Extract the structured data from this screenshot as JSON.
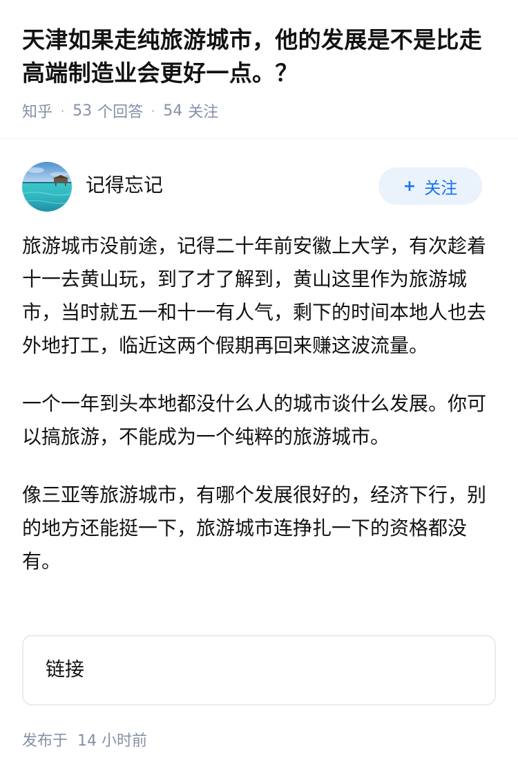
{
  "question": {
    "title": "天津如果走纯旅游城市，他的发展是不是比走高端制造业会更好一点。？",
    "source": "知乎",
    "answer_count": "53",
    "answer_label": "个回答",
    "follower_count": "54",
    "follower_label": "关注"
  },
  "answer": {
    "author_name": "记得忘记",
    "follow_label": "关注",
    "follow_plus": "+",
    "paragraphs": [
      "旅游城市没前途，记得二十年前安徽上大学，有次趁着十一去黄山玩，到了才了解到，黄山这里作为旅游城市，当时就五一和十一有人气，剩下的时间本地人也去外地打工，临近这两个假期再回来赚这波流量。",
      "一个一年到头本地都没什么人的城市谈什么发展。你可以搞旅游，不能成为一个纯粹的旅游城市。",
      "像三亚等旅游城市，有哪个发展很好的，经济下行，别的地方还能挺一下，旅游城市连挣扎一下的资格都没有。"
    ],
    "link_card_label": "链接",
    "publish_prefix": "发布于",
    "publish_time": "14 小时前"
  },
  "colors": {
    "accent": "#1772f6",
    "meta_text": "#8590a6",
    "follow_bg": "#eaf2fb"
  }
}
